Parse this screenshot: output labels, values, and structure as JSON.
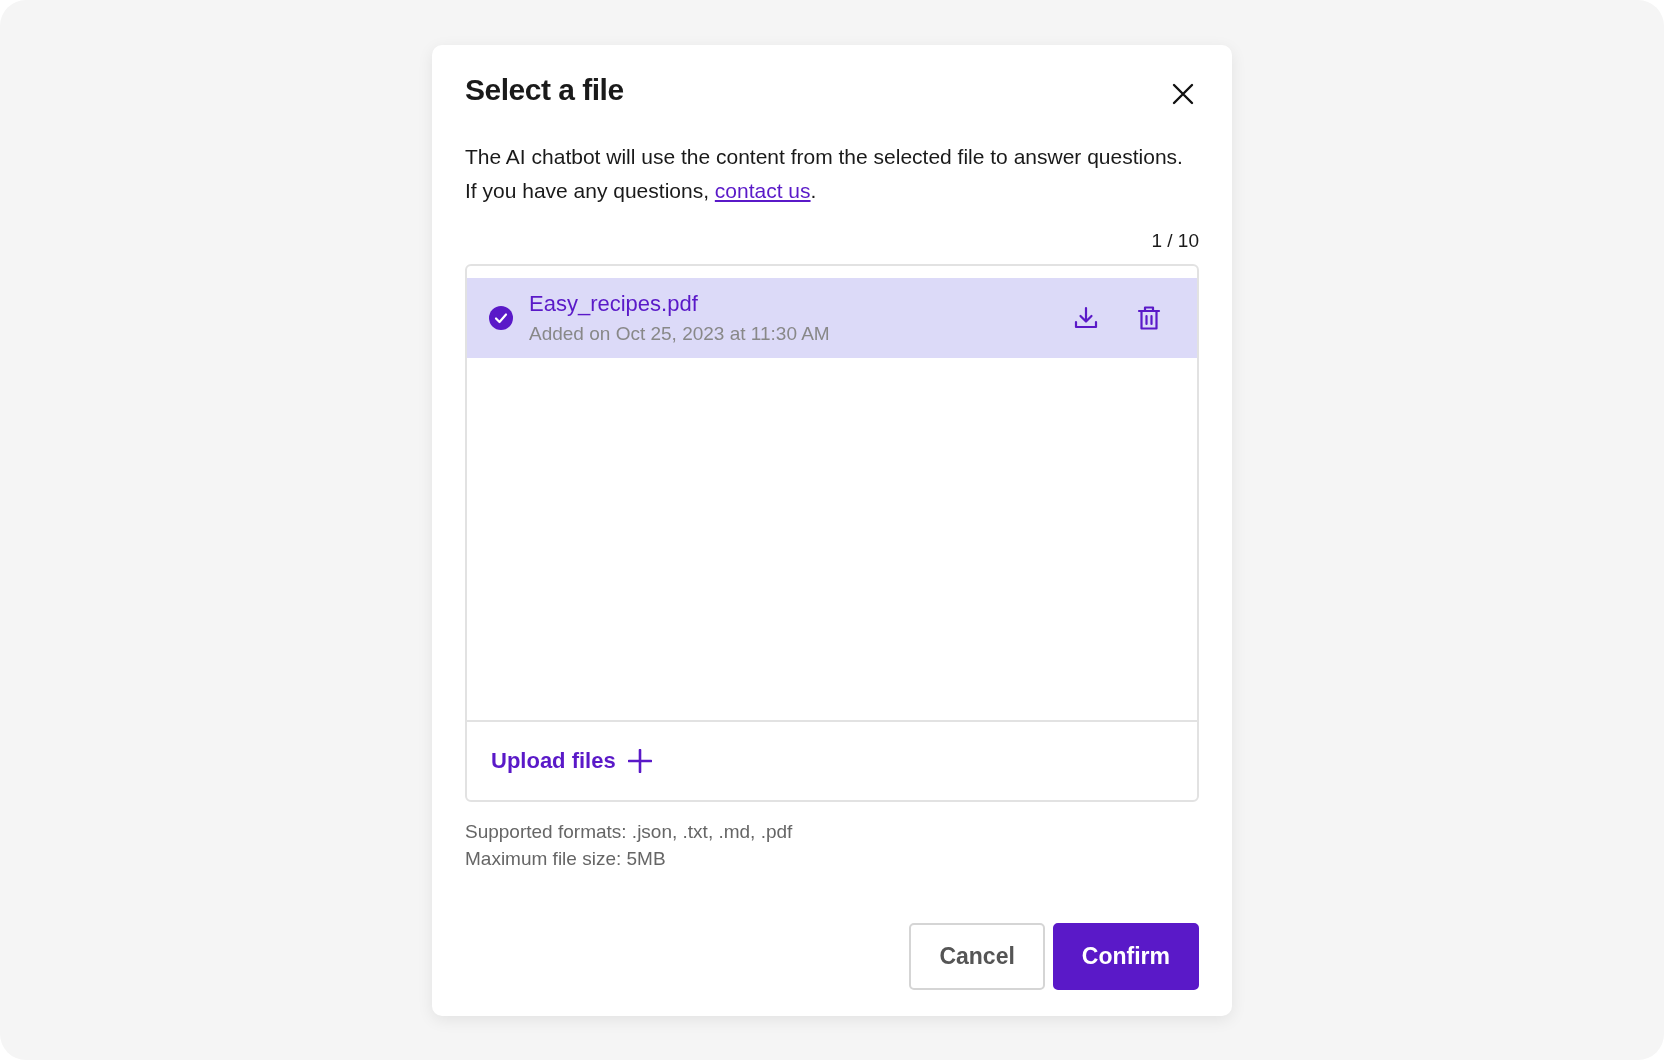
{
  "dialog": {
    "title": "Select a file",
    "description": {
      "before": "The AI chatbot will use the content from the selected file to answer questions. If you have any questions, ",
      "link": "contact us",
      "after": "."
    },
    "counter": "1 / 10",
    "files": [
      {
        "name": "Easy_recipes.pdf",
        "added": "Added on Oct 25, 2023 at 11:30 AM",
        "selected": true
      }
    ],
    "upload": "Upload files",
    "hints": [
      "Supported formats: .json, .txt, .md, .pdf",
      "Maximum file size: 5MB"
    ],
    "buttons": [
      {
        "label": "Cancel",
        "kind": "secondary"
      },
      {
        "label": "Confirm",
        "kind": "primary"
      }
    ]
  }
}
